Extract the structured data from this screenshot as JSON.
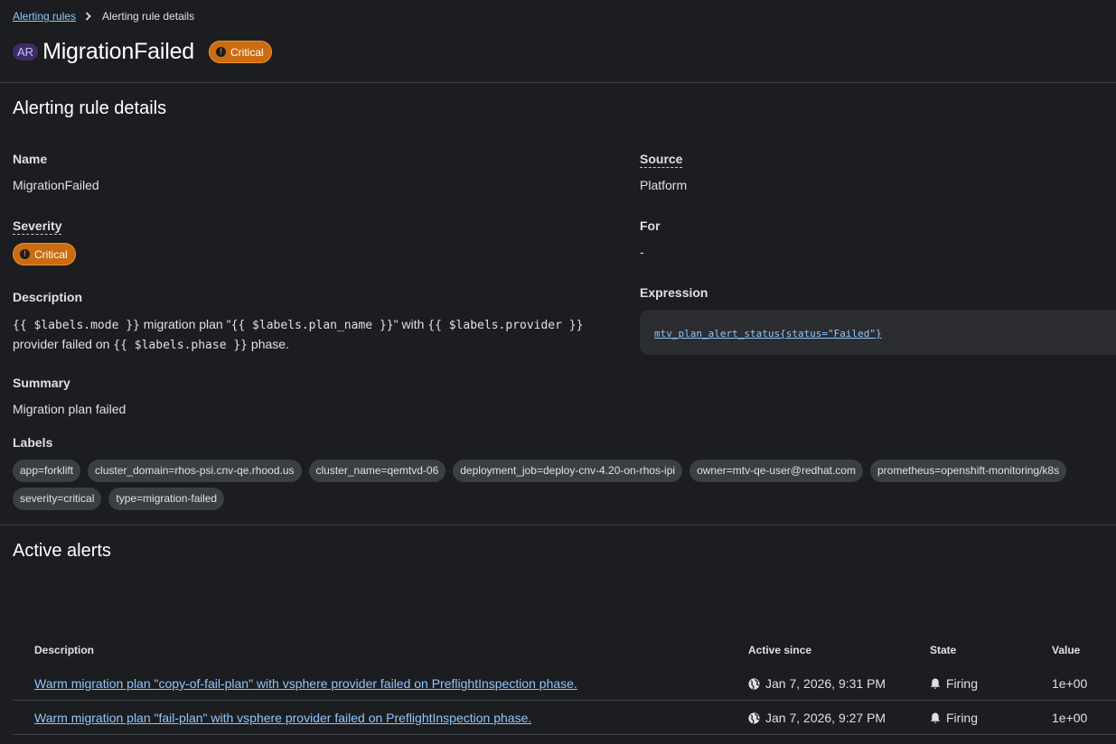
{
  "breadcrumb": {
    "parent": "Alerting rules",
    "current": "Alerting rule details"
  },
  "header": {
    "badge": "AR",
    "title": "MigrationFailed",
    "severity": "Critical"
  },
  "details": {
    "section_title": "Alerting rule details",
    "name_label": "Name",
    "name_value": "MigrationFailed",
    "severity_label": "Severity",
    "severity_value": "Critical",
    "description_label": "Description",
    "description": {
      "t1": "{{ $labels.mode }}",
      "t2": " migration plan \"",
      "t3": "{{ $labels.plan_name }}",
      "t4": "\" with ",
      "t5": "{{ $labels.provider }}",
      "t6": " provider failed on ",
      "t7": "{{ $labels.phase }}",
      "t8": " phase."
    },
    "summary_label": "Summary",
    "summary_value": "Migration plan failed",
    "source_label": "Source",
    "source_value": "Platform",
    "for_label": "For",
    "for_value": "-",
    "expression_label": "Expression",
    "expression_value": "mtv_plan_alert_status{status=\"Failed\"}",
    "labels_label": "Labels",
    "labels": [
      "app=forklift",
      "cluster_domain=rhos-psi.cnv-qe.rhood.us",
      "cluster_name=qemtvd-06",
      "deployment_job=deploy-cnv-4.20-on-rhos-ipi",
      "owner=mtv-qe-user@redhat.com",
      "prometheus=openshift-monitoring/k8s",
      "severity=critical",
      "type=migration-failed"
    ]
  },
  "active_alerts": {
    "section_title": "Active alerts",
    "columns": {
      "description": "Description",
      "active_since": "Active since",
      "state": "State",
      "value": "Value"
    },
    "rows": [
      {
        "description": "Warm migration plan \"copy-of-fail-plan\" with vsphere provider failed on PreflightInspection phase.",
        "active_since": "Jan 7, 2026, 9:31 PM",
        "state": "Firing",
        "value": "1e+00"
      },
      {
        "description": "Warm migration plan \"fail-plan\" with vsphere provider failed on PreflightInspection phase.",
        "active_since": "Jan 7, 2026, 9:27 PM",
        "state": "Firing",
        "value": "1e+00"
      }
    ]
  },
  "colors": {
    "background": "#1b1d21",
    "link": "#92c5f9",
    "critical": "#ca6c0f",
    "chip": "#3c3f42"
  }
}
